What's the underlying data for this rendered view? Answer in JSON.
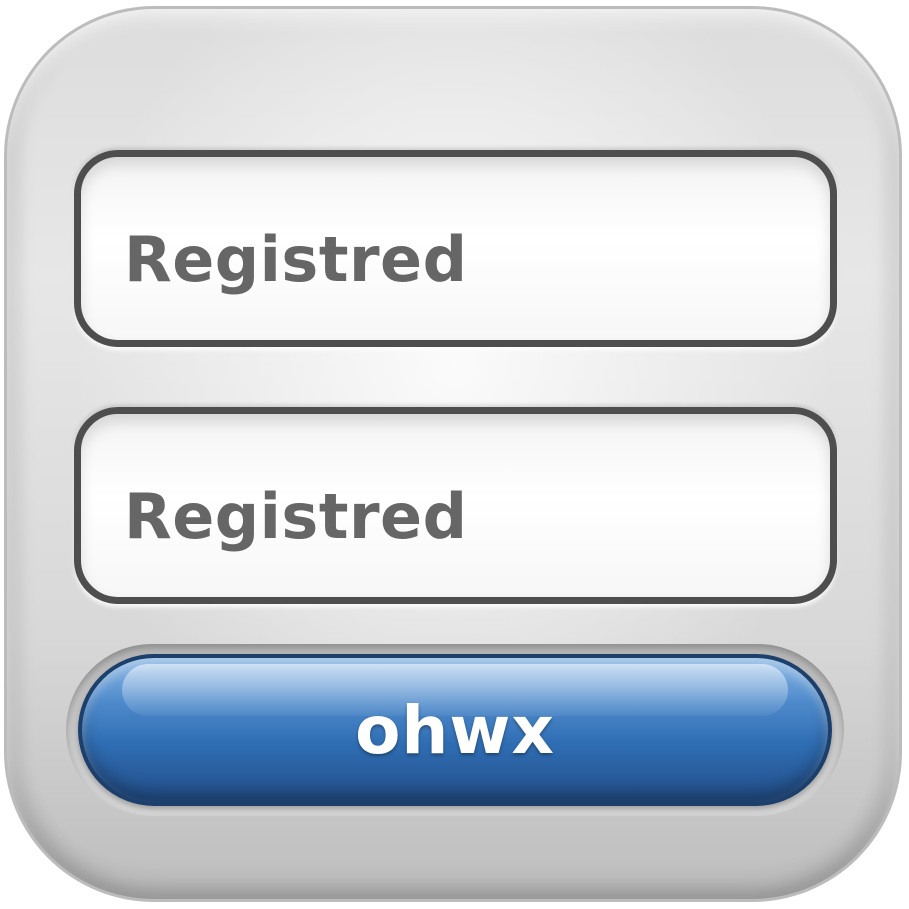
{
  "form": {
    "fields": [
      {
        "value": "Registred"
      },
      {
        "value": "Registred"
      }
    ],
    "button": {
      "label": "ohwx"
    }
  },
  "colors": {
    "panel": "#d9d9d9",
    "field_border": "#4e4e4e",
    "field_text": "#666666",
    "button": "#2f6db3",
    "button_text": "#ffffff"
  }
}
